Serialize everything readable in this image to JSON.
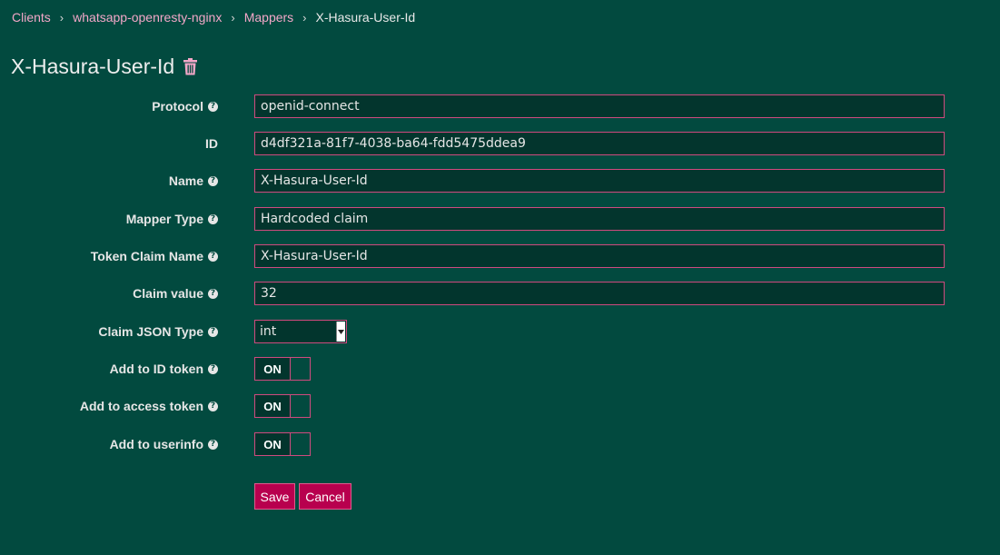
{
  "breadcrumb": {
    "items": [
      "Clients",
      "whatsapp-openresty-nginx",
      "Mappers"
    ],
    "current": "X-Hasura-User-Id"
  },
  "header": {
    "title": "X-Hasura-User-Id",
    "delete_icon": "trash-icon"
  },
  "form": {
    "protocol": {
      "label": "Protocol",
      "value": "openid-connect"
    },
    "id": {
      "label": "ID",
      "value": "d4df321a-81f7-4038-ba64-fdd5475ddea9"
    },
    "name": {
      "label": "Name",
      "value": "X-Hasura-User-Id"
    },
    "mapper_type": {
      "label": "Mapper Type",
      "value": "Hardcoded claim"
    },
    "token_claim_name": {
      "label": "Token Claim Name",
      "value": "X-Hasura-User-Id"
    },
    "claim_value": {
      "label": "Claim value",
      "value": "32"
    },
    "claim_json_type": {
      "label": "Claim JSON Type",
      "value": "int"
    },
    "add_to_id_token": {
      "label": "Add to ID token",
      "state": "ON"
    },
    "add_to_access_token": {
      "label": "Add to access token",
      "state": "ON"
    },
    "add_to_userinfo": {
      "label": "Add to userinfo",
      "state": "ON"
    }
  },
  "actions": {
    "save_label": "Save",
    "cancel_label": "Cancel"
  },
  "colors": {
    "background": "#024a3f",
    "input_background": "#02352d",
    "accent": "#b8004e",
    "border": "#d04a7f",
    "link": "#f3a7c8"
  }
}
